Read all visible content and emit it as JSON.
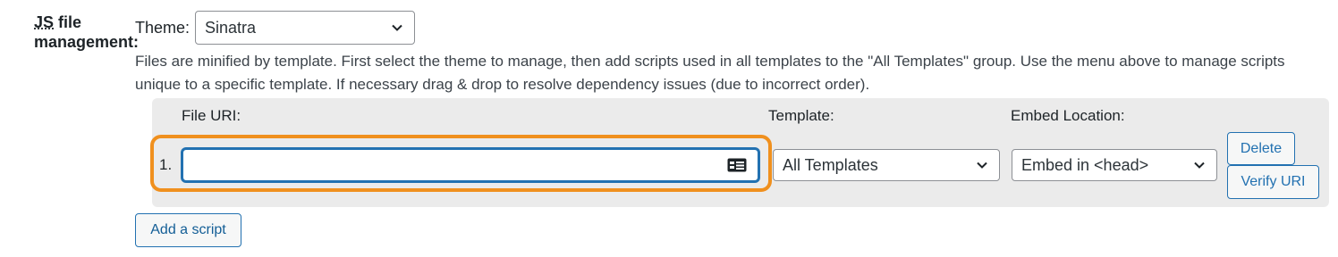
{
  "setting": {
    "label_prefix": "JS",
    "label_line1_rest": " file",
    "label_line2": "management:"
  },
  "theme": {
    "label": "Theme:",
    "selected": "Sinatra"
  },
  "description": "Files are minified by template. First select the theme to manage, then add scripts used in all templates to the \"All Templates\" group. Use the menu above to manage scripts unique to a specific template. If necessary drag & drop to resolve dependency issues (due to incorrect order).",
  "table": {
    "headers": {
      "file_uri": "File URI:",
      "template": "Template:",
      "embed_location": "Embed Location:"
    },
    "rows": [
      {
        "number": "1.",
        "file_uri_value": "",
        "template": "All Templates",
        "embed_location": "Embed in <head>",
        "delete_label": "Delete",
        "verify_label": "Verify URI"
      }
    ]
  },
  "add_script_label": "Add a script",
  "colors": {
    "accent": "#2271b1",
    "highlight": "#f0901e",
    "panel_bg": "#ebebeb"
  },
  "icons": {
    "dropdown": "chevron-down-icon",
    "autofill": "contact-card-icon"
  }
}
